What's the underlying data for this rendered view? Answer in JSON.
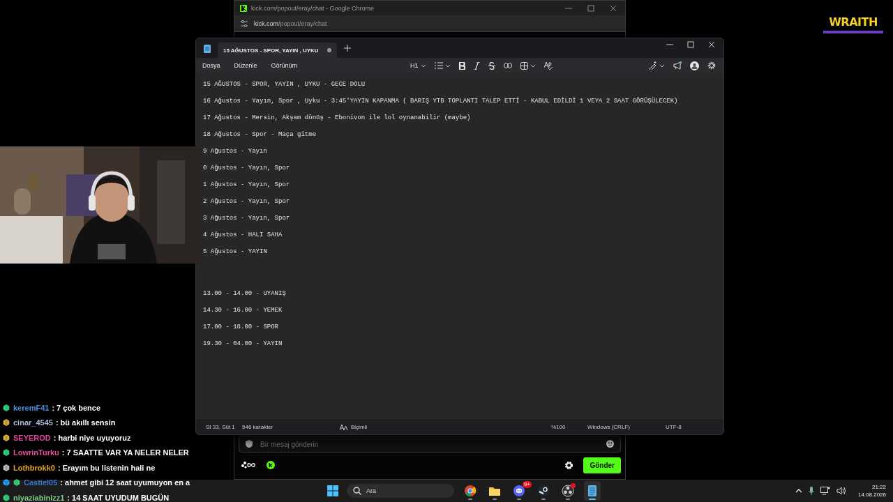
{
  "logo": {
    "text": "WRAITH"
  },
  "browser": {
    "title": "kick.com/popout/eray/chat - Google Chrome",
    "address_host": "kick.com",
    "address_path": "/popout/eray/chat",
    "chat_input": {
      "placeholder": "Bir mesaj gönderin"
    },
    "send_button": "Gönder"
  },
  "notepad": {
    "tabs": [
      {
        "label": "15 AĞUSTOS - SPOR, YAYIN , UYKU",
        "selected": true,
        "modified": true
      }
    ],
    "menu": [
      "Dosya",
      "Düzenle",
      "Görünüm"
    ],
    "heading_button": "H1",
    "lines": [
      "15 AĞUSTOS - SPOR, YAYIN , UYKU - GECE DOLU",
      "16 Ağustos - Yayın, Spor , Uyku - 3:45'YAYIN KAPANMA ( BARIŞ YTB TOPLANTI TALEP ETTİ - KABUL EDİLDİ 1 VEYA 2 SAAT GÖRÜŞÜLECEK)",
      "17 Ağustos - Mersin, Akşam dönüş - Ebonivon ile lol oynanabilir (maybe)",
      "18 Ağustos - Spor - Maça gitme",
      "9 Ağustos - Yayın",
      "0 Ağustos - Yayın, Spor",
      "1 Ağustos - Yayın, Spor",
      "2 Ağustos - Yayın, Spor",
      "3 Ağustos - Yayın, Spor",
      "4 Ağustos - HALI SAHA",
      "5 Ağustos - YAYIN"
    ],
    "schedule": [
      "13.00 - 14.00 - UYANIŞ",
      "14.30 - 16.00 - YEMEK",
      "17.00 - 18.00 - SPOR",
      "19.30 - 04.00 - YAYIN"
    ],
    "status_bar": {
      "position": "St 33, Süt 1",
      "characters": "546 karakter",
      "format": "Biçimli",
      "zoom": "%100",
      "line_endings": "Windows (CRLF)",
      "encoding": "UTF-8"
    }
  },
  "chat": [
    {
      "user": "keremF41",
      "color": "#4d8fe0",
      "kind": "sub",
      "message": ": 7 çok bence"
    },
    {
      "user": "cinar_4545",
      "color": "#a9bde0",
      "kind": "gold",
      "message": ": bü akıllı sensin"
    },
    {
      "user": "SEYEROD",
      "color": "#e2449c",
      "kind": "gold",
      "message": ": harbi niye uyuyoruz"
    },
    {
      "user": "LowrinTurku",
      "color": "#e5509a",
      "kind": "sub",
      "message": ": 7 SAATTE VAR YA NELER NELER"
    },
    {
      "user": "Lothbrokk0",
      "color": "#e9a62a",
      "kind": "grey",
      "message": ": Erayım bu listenin hali ne"
    },
    {
      "user": "Castiel05",
      "color": "#3c78d0",
      "kind": "cubesub",
      "message": ": ahmet gibi 12 saat uyumuyon en a"
    },
    {
      "user": "niyaziabinizz1",
      "color": "#7fd08a",
      "kind": "sub",
      "message": ": 14 SAAT UYUDUM BUGÜN"
    }
  ],
  "taskbar": {
    "search": {
      "placeholder": "Ara"
    },
    "apps": [
      {
        "kind": "chrome",
        "selected": false
      },
      {
        "kind": "folder",
        "selected": false
      },
      {
        "kind": "discord",
        "selected": false,
        "badge": "9+"
      },
      {
        "kind": "steam",
        "selected": false
      },
      {
        "kind": "obs",
        "selected": false
      },
      {
        "kind": "notepad",
        "selected": true
      }
    ],
    "time": "21:22",
    "date": "14.08.2026"
  }
}
